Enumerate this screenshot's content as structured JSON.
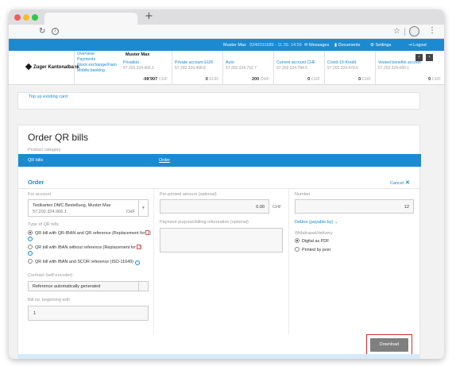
{
  "browser": {
    "reload_icon": "reload-icon",
    "info_icon": "info-icon",
    "star_icon": "star-icon",
    "profile_icon": "profile-icon",
    "menu_icon": "menu-icon"
  },
  "topbar": {
    "user": "Muster Max",
    "contract_info": "9340031689 - 11.09. 14:59",
    "messages": "Messages",
    "documents": "Documents",
    "settings": "Settings",
    "logout": "Logout"
  },
  "bank": {
    "name": "Zuger Kantonalbank"
  },
  "nav": {
    "items": [
      "Overview",
      "Payments",
      "Stock exchange/Fiam",
      "Mobile banking"
    ]
  },
  "account_holder": "Muster Max",
  "accounts": [
    {
      "name": "Privatkto",
      "number": "57.202.324.966.1",
      "balance": "-98'997",
      "currency": "CHF"
    },
    {
      "name": "Private account EUR",
      "number": "57.202.324.468.8",
      "balance": "0",
      "currency": "EUR"
    },
    {
      "name": "Auto",
      "number": "57.202.324.752.7",
      "balance": "200",
      "currency": "CHF"
    },
    {
      "name": "Current account CHF",
      "number": "57.202.324.784.5",
      "balance": "0",
      "currency": "CHF"
    },
    {
      "name": "Covid-19-Kredit",
      "number": "57.202.324.470.6",
      "balance": "0",
      "currency": "CHF"
    },
    {
      "name": "Vested benefits accoun",
      "number": "57.202.324.089.1",
      "balance": "0",
      "currency": "CHF"
    }
  ],
  "topup": {
    "link": "Top up existing card"
  },
  "order_qr": {
    "title": "Order QR bills",
    "product_category_label": "Product category",
    "product_name": "QR bills",
    "product_action": "Order",
    "order_heading": "Order",
    "cancel": "Cancel",
    "for_account_label": "For account",
    "account_select": {
      "name": "Testkarten DMC Bestellung, Muster Max",
      "number": "57.202.324.966.1",
      "currency": "CHF"
    },
    "type_label": "Type of QR bills",
    "types": [
      {
        "label": "QR bill with QR-IBAN and QR reference (Replacement for",
        "selected": true
      },
      {
        "label": "QR bill with IBAN without reference (Replacement for",
        "selected": false
      },
      {
        "label": "QR bill with IBAN and SCOR reference (ISO-11649)",
        "selected": false
      }
    ],
    "contract_label": "Contract (self-encoder)",
    "contract_value": "Reference automatically generated",
    "bill_no_label": "Bill no. beginning with",
    "bill_no_value": "1",
    "preprinted_label": "Pre-printed amount (optional)",
    "preprinted_value": "0.00",
    "preprinted_currency": "CHF",
    "purpose_label": "Payment purpose/billing information (optional)",
    "number_label": "Number",
    "number_value": "12",
    "debtor_label": "Debtor (payable by)",
    "withdrawal_label": "Withdrawal/delivery",
    "withdrawal_options": [
      {
        "label": "Digital as PDF",
        "selected": true
      },
      {
        "label": "Printed by post",
        "selected": false
      }
    ],
    "download": "Download"
  },
  "colors": {
    "brand_blue": "#1b8ad1",
    "highlight_red": "#d9282f",
    "button_grey": "#7f7f7f"
  }
}
